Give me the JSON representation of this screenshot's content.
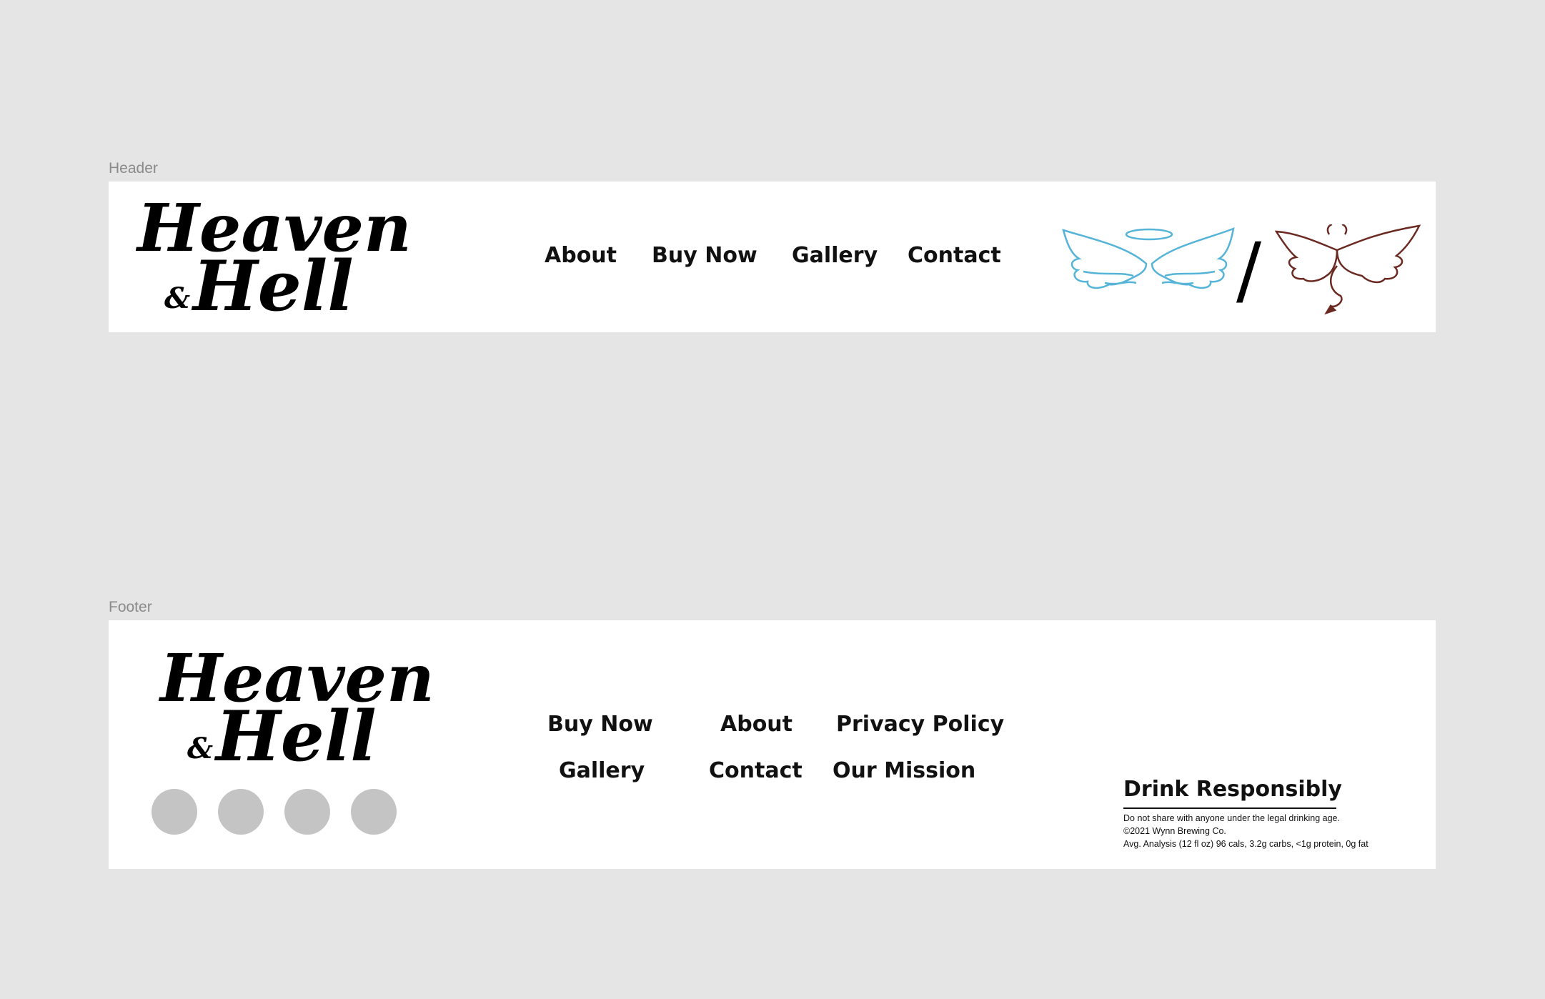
{
  "colors": {
    "canvas_bg": "#e5e5e5",
    "frame_bg": "#ffffff",
    "text": "#111111",
    "angel_wings": "#55b4d8",
    "devil_wings": "#6a2a22",
    "social_placeholder": "#c4c4c4"
  },
  "header_frame": {
    "label": "Header",
    "logo": {
      "line1": "Heaven",
      "ampersand": "&",
      "line2": "Hell"
    },
    "nav": [
      "About",
      "Buy Now",
      "Gallery",
      "Contact"
    ],
    "theme_toggle": {
      "left_icon": "angel-wings-icon",
      "divider": "/",
      "right_icon": "devil-wings-icon"
    }
  },
  "footer_frame": {
    "label": "Footer",
    "logo": {
      "line1": "Heaven",
      "ampersand": "&",
      "line2": "Hell"
    },
    "social_icons": [
      "social-icon-placeholder",
      "social-icon-placeholder",
      "social-icon-placeholder",
      "social-icon-placeholder"
    ],
    "links_row1": [
      "Buy Now",
      "About",
      "Privacy Policy"
    ],
    "links_row2": [
      "Gallery",
      "Contact",
      "Our Mission"
    ],
    "drink_responsibly": {
      "title": "Drink Responsibly",
      "lines": [
        "Do not share with anyone under the legal drinking age.",
        "©2021 Wynn Brewing Co.",
        "Avg. Analysis (12 fl oz) 96 cals, 3.2g carbs, <1g protein, 0g fat"
      ]
    }
  }
}
